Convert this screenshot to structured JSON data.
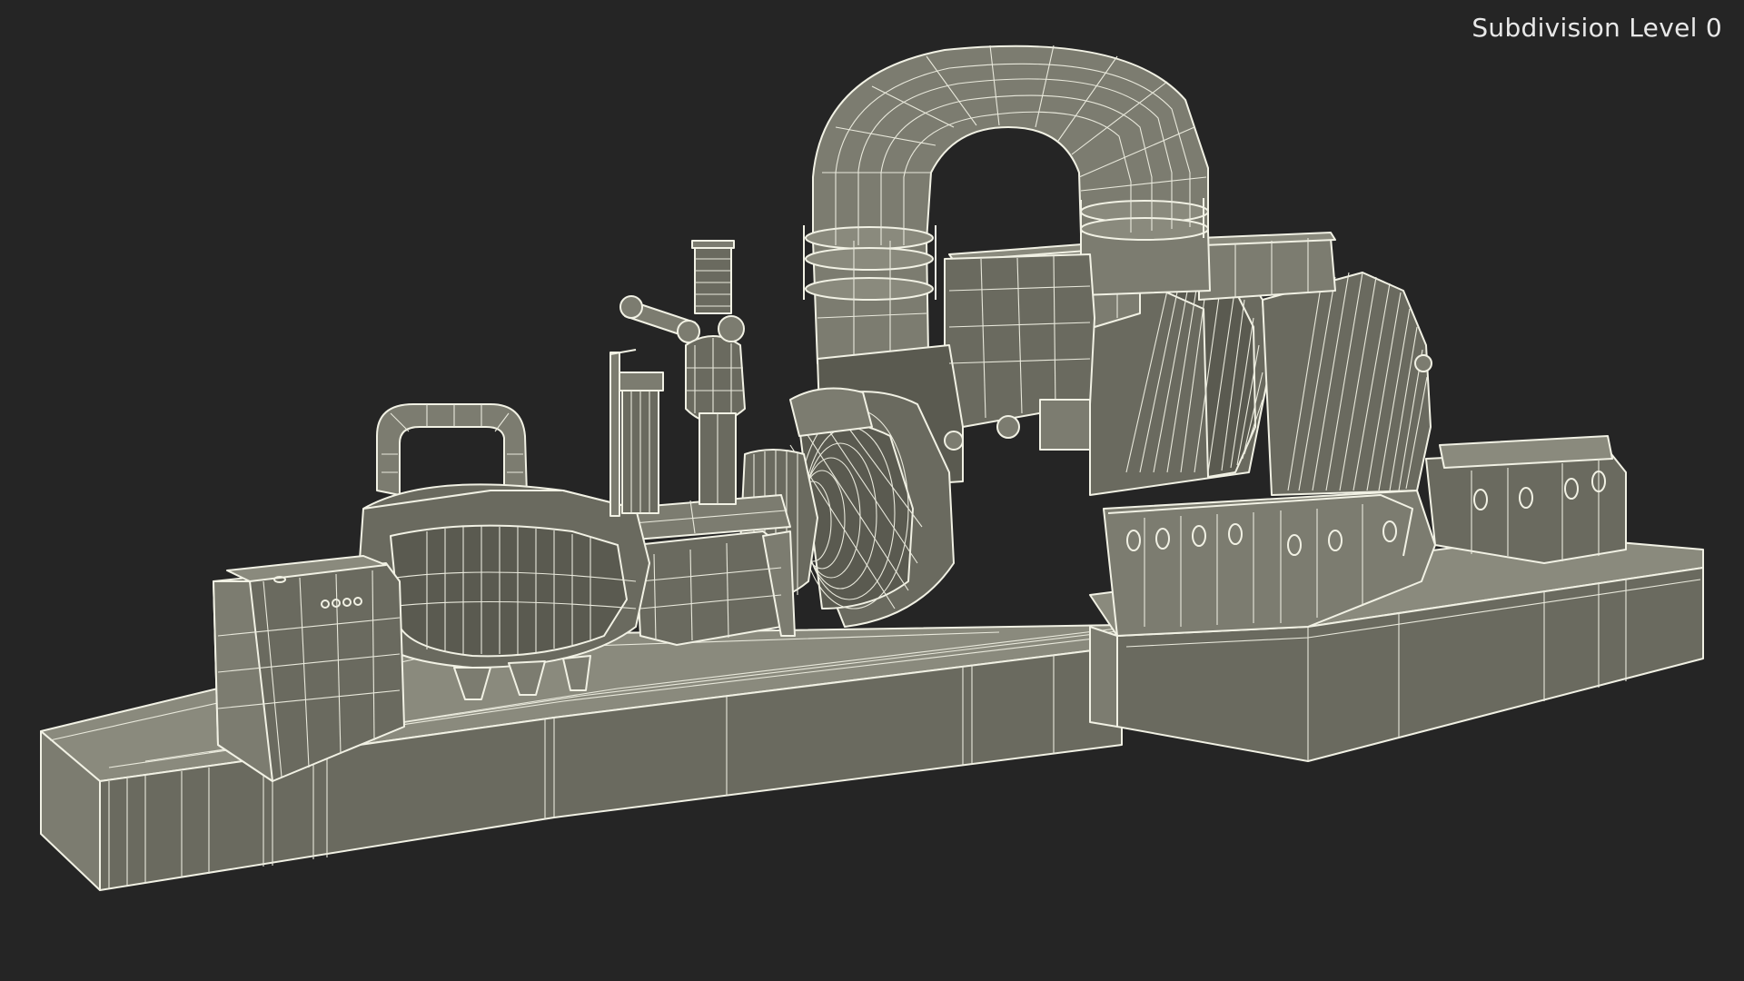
{
  "viewport": {
    "label": "Subdivision Level 0",
    "background_color": "#252525",
    "wire_color": "#f1f1e4",
    "surface_color": "#7c7c70"
  },
  "model": {
    "subject": "steam-turbine-generator-wireframe"
  }
}
